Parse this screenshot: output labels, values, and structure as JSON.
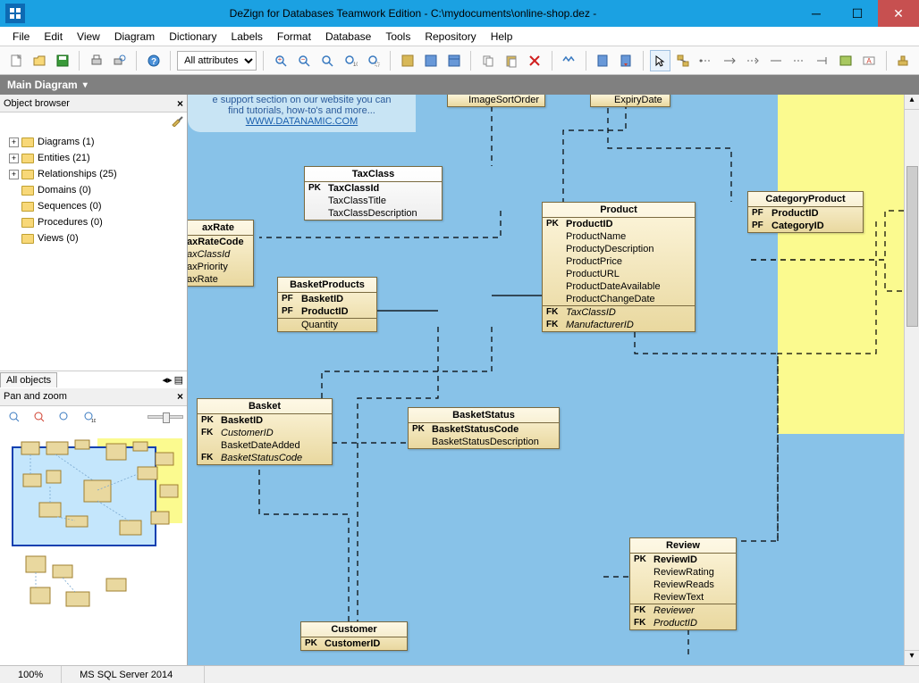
{
  "title": "DeZign for Databases Teamwork Edition - C:\\mydocuments\\online-shop.dez -",
  "menu": [
    "File",
    "Edit",
    "View",
    "Diagram",
    "Dictionary",
    "Labels",
    "Format",
    "Database",
    "Tools",
    "Repository",
    "Help"
  ],
  "toolbar": {
    "attr_selector": "All attributes"
  },
  "diagram_tab": "Main Diagram",
  "object_browser": {
    "title": "Object browser",
    "items": [
      {
        "label": "Diagrams (1)",
        "expandable": true
      },
      {
        "label": "Entities (21)",
        "expandable": true
      },
      {
        "label": "Relationships (25)",
        "expandable": true
      },
      {
        "label": "Domains (0)",
        "expandable": false
      },
      {
        "label": "Sequences (0)",
        "expandable": false
      },
      {
        "label": "Procedures (0)",
        "expandable": false
      },
      {
        "label": "Views (0)",
        "expandable": false
      }
    ],
    "filter_tab": "All objects"
  },
  "pan_zoom": {
    "title": "Pan and zoom"
  },
  "help_box": {
    "line1": "e support section on our website you can",
    "line2": "find tutorials, how-to's and more...",
    "link": "WWW.DATANAMIC.COM"
  },
  "entities": {
    "imagesortorder": {
      "title": "",
      "rows": [
        {
          "k": "",
          "n": "ImageSortOrder"
        }
      ]
    },
    "expirydate": {
      "title": "",
      "rows": [
        {
          "k": "",
          "n": "ExpiryDate"
        }
      ]
    },
    "taxclass": {
      "title": "TaxClass",
      "rows": [
        {
          "k": "PK",
          "n": "TaxClassId"
        },
        {
          "k": "",
          "n": "TaxClassTitle"
        },
        {
          "k": "",
          "n": "TaxClassDescription"
        }
      ]
    },
    "taxrate": {
      "title": "axRate",
      "rows": [
        {
          "k": "",
          "n": "axRateCode",
          "bold": true
        },
        {
          "k": "",
          "n": "axClassId",
          "fk": true
        },
        {
          "k": "",
          "n": "axPriority"
        },
        {
          "k": "",
          "n": "axRate"
        }
      ]
    },
    "basketproducts": {
      "title": "BasketProducts",
      "rows": [
        {
          "k": "PF",
          "n": "BasketID",
          "bold": true
        },
        {
          "k": "PF",
          "n": "ProductID",
          "bold": true
        },
        {
          "k": "",
          "n": "Quantity"
        }
      ]
    },
    "product": {
      "title": "Product",
      "rows": [
        {
          "k": "PK",
          "n": "ProductID",
          "bold": true
        },
        {
          "k": "",
          "n": "ProductName"
        },
        {
          "k": "",
          "n": "ProductyDescription"
        },
        {
          "k": "",
          "n": "ProductPrice"
        },
        {
          "k": "",
          "n": "ProductURL"
        },
        {
          "k": "",
          "n": "ProductDateAvailable"
        },
        {
          "k": "",
          "n": "ProductChangeDate"
        },
        {
          "k": "FK",
          "n": "TaxClassID",
          "fk": true
        },
        {
          "k": "FK",
          "n": "ManufacturerID",
          "fk": true
        }
      ]
    },
    "categoryproduct": {
      "title": "CategoryProduct",
      "rows": [
        {
          "k": "PF",
          "n": "ProductID",
          "bold": true
        },
        {
          "k": "PF",
          "n": "CategoryID",
          "bold": true
        }
      ]
    },
    "basket": {
      "title": "Basket",
      "rows": [
        {
          "k": "PK",
          "n": "BasketID",
          "bold": true
        },
        {
          "k": "FK",
          "n": "CustomerID",
          "fk": true
        },
        {
          "k": "",
          "n": "BasketDateAdded"
        },
        {
          "k": "FK",
          "n": "BasketStatusCode",
          "fk": true
        }
      ]
    },
    "basketstatus": {
      "title": "BasketStatus",
      "rows": [
        {
          "k": "PK",
          "n": "BasketStatusCode",
          "bold": true
        },
        {
          "k": "",
          "n": "BasketStatusDescription"
        }
      ]
    },
    "review": {
      "title": "Review",
      "rows": [
        {
          "k": "PK",
          "n": "ReviewID",
          "bold": true
        },
        {
          "k": "",
          "n": "ReviewRating"
        },
        {
          "k": "",
          "n": "ReviewReads"
        },
        {
          "k": "",
          "n": "ReviewText"
        },
        {
          "k": "FK",
          "n": "Reviewer",
          "fk": true
        },
        {
          "k": "FK",
          "n": "ProductID",
          "fk": true
        }
      ]
    },
    "customer": {
      "title": "Customer",
      "rows": [
        {
          "k": "PK",
          "n": "CustomerID",
          "bold": true
        }
      ]
    }
  },
  "status": {
    "zoom": "100%",
    "db": "MS SQL Server 2014"
  }
}
